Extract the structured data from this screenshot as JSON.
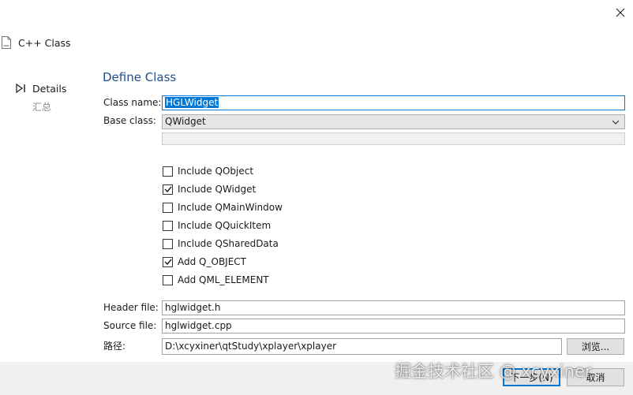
{
  "window": {
    "title": "C++ Class"
  },
  "steps": {
    "current": "Details",
    "summary": "汇总"
  },
  "page": {
    "title": "Define Class"
  },
  "form": {
    "class_name_label": "Class name:",
    "class_name_value": "HGLWidget",
    "base_class_label": "Base class:",
    "base_class_value": "QWidget",
    "header_file_label": "Header file:",
    "header_file_value": "hglwidget.h",
    "source_file_label": "Source file:",
    "source_file_value": "hglwidget.cpp",
    "path_label": "路径:",
    "path_value": "D:\\xcyxiner\\qtStudy\\xplayer\\xplayer",
    "browse_label": "浏览..."
  },
  "options": [
    {
      "label": "Include QObject",
      "checked": false
    },
    {
      "label": "Include QWidget",
      "checked": true
    },
    {
      "label": "Include QMainWindow",
      "checked": false
    },
    {
      "label": "Include QQuickItem",
      "checked": false
    },
    {
      "label": "Include QSharedData",
      "checked": false
    },
    {
      "label": "Add Q_OBJECT",
      "checked": true
    },
    {
      "label": "Add QML_ELEMENT",
      "checked": false
    }
  ],
  "buttons": {
    "next": "下一步(N)",
    "cancel": "取消"
  },
  "watermark": "掘金技术社区 @ xcyxiner",
  "colors": {
    "accent": "#0078d7",
    "title_blue": "#1f4e8c"
  }
}
